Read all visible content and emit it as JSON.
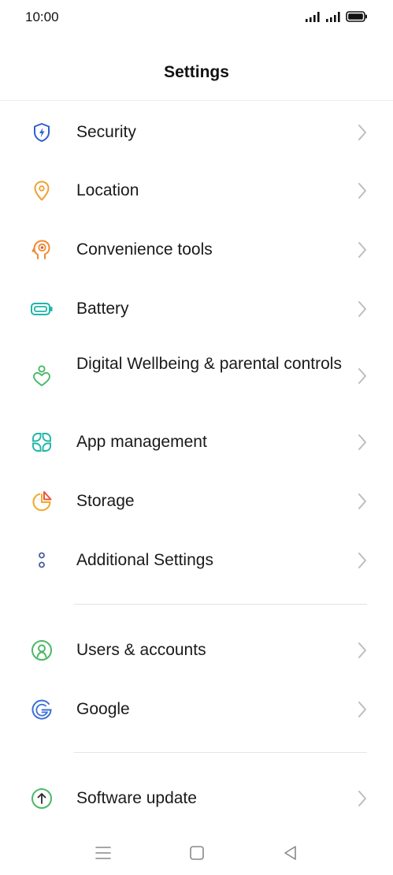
{
  "status_bar": {
    "time": "10:00",
    "icons": [
      "signal-icon",
      "signal-icon",
      "battery-full-icon"
    ]
  },
  "header": {
    "title": "Settings"
  },
  "colors": {
    "security": "#2f5fd0",
    "location": "#f0a030",
    "convenience": "#f08a30",
    "battery": "#1fb6a6",
    "wellbeing": "#4cb866",
    "app_management": "#1fb6a6",
    "storage_orange": "#f5a623",
    "storage_red": "#e8573a",
    "additional": "#4a5f9a",
    "users": "#4cb866",
    "google": "#3b6fd8",
    "software_update": "#4cb866",
    "chevron": "#bdbdbd"
  },
  "settings": {
    "items": [
      {
        "label": "Security",
        "icon": "shield-bolt-icon"
      },
      {
        "label": "Location",
        "icon": "location-pin-icon"
      },
      {
        "label": "Convenience tools",
        "icon": "convenience-tools-icon"
      },
      {
        "label": "Battery",
        "icon": "battery-icon"
      },
      {
        "label": "Digital Wellbeing & parental controls",
        "icon": "wellbeing-icon"
      },
      {
        "label": "App management",
        "icon": "app-grid-icon"
      },
      {
        "label": "Storage",
        "icon": "storage-pie-icon"
      },
      {
        "label": "Additional Settings",
        "icon": "dots-icon"
      },
      {
        "label": "Users & accounts",
        "icon": "user-icon"
      },
      {
        "label": "Google",
        "icon": "google-icon"
      },
      {
        "label": "Software update",
        "icon": "update-arrow-icon"
      }
    ]
  },
  "nav_bar": {
    "buttons": [
      "menu-icon",
      "home-icon",
      "back-icon"
    ]
  }
}
